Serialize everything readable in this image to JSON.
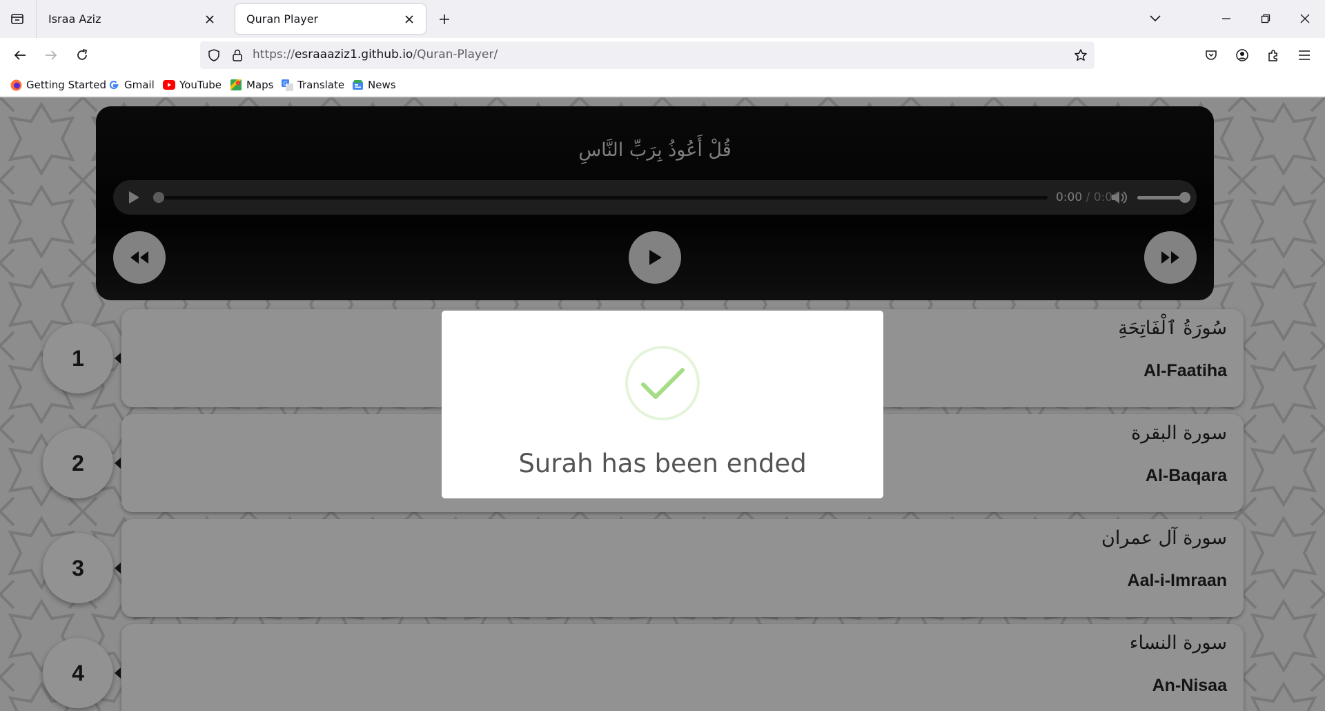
{
  "browser": {
    "tabs": [
      {
        "title": "Israa Aziz",
        "active": false
      },
      {
        "title": "Quran Player",
        "active": true
      }
    ],
    "url": {
      "scheme": "https://",
      "host": "esraaaziz1.github.io",
      "path": "/Quran-Player/"
    },
    "bookmarks": [
      {
        "label": "Getting Started",
        "icon": "firefox-icon"
      },
      {
        "label": "Gmail",
        "icon": "google-icon"
      },
      {
        "label": "YouTube",
        "icon": "youtube-icon"
      },
      {
        "label": "Maps",
        "icon": "maps-icon"
      },
      {
        "label": "Translate",
        "icon": "translate-icon"
      },
      {
        "label": "News",
        "icon": "news-icon"
      }
    ]
  },
  "player": {
    "ayah": "قُلْ أَعُوذُ بِرَبِّ النَّاسِ",
    "current_time": "0:00",
    "duration": "0:06",
    "time_separator": "/",
    "progress": 0,
    "volume": 1.0
  },
  "surahs": [
    {
      "number": "1",
      "arabic": "سُورَةُ ٱلْفَاتِحَةِ",
      "english": "Al-Faatiha"
    },
    {
      "number": "2",
      "arabic": "سورة البقرة",
      "english": "Al-Baqara"
    },
    {
      "number": "3",
      "arabic": "سورة آل عمران",
      "english": "Aal-i-Imraan"
    },
    {
      "number": "4",
      "arabic": "سورة النساء",
      "english": "An-Nisaa"
    }
  ],
  "modal": {
    "icon": "success-check-icon",
    "title": "Surah has been ended"
  },
  "colors": {
    "success": "#a5dc86",
    "player_bg": "#050505",
    "card_bg": "#f4f4f4"
  }
}
